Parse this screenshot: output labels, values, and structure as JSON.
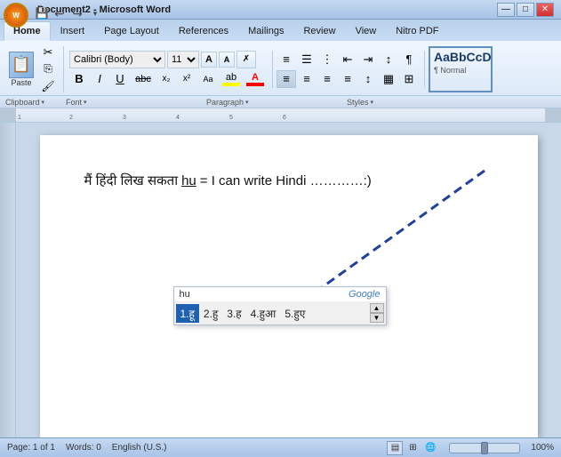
{
  "titlebar": {
    "title": "Document2 - Microsoft Word",
    "min": "—",
    "max": "□",
    "close": "✕"
  },
  "ribbon": {
    "tabs": [
      "Home",
      "Insert",
      "Page Layout",
      "References",
      "Mailings",
      "Review",
      "View",
      "Nitro PDF"
    ],
    "active_tab": "Home"
  },
  "toolbar": {
    "clipboard": "Clipboard",
    "paste": "Paste",
    "cut": "✂",
    "copy": "⎘",
    "format_painter": "🖌",
    "font_name": "Calibri (Body)",
    "font_size": "11",
    "grow": "A",
    "shrink": "A",
    "clear": "✗",
    "aa_upper": "Aa",
    "bold": "B",
    "italic": "I",
    "underline": "U",
    "strikethrough": "abc",
    "subscript": "x₂",
    "superscript": "x²",
    "font_section": "Font",
    "para_section": "Paragraph",
    "styles_section": "Styles",
    "style_preview": "AaBbCcD",
    "style_name": "¶ Normal"
  },
  "document": {
    "line1_hindi": "मैं हिंदी लिख सकता",
    "line1_typed": "hu",
    "line1_english": "= I can write Hindi …………:)",
    "cursor_text": "hu"
  },
  "autocomplete": {
    "typed": "hu",
    "google_label": "Google",
    "items": [
      {
        "id": 1,
        "text": "1.हू",
        "selected": true
      },
      {
        "id": 2,
        "text": "2.हु"
      },
      {
        "id": 3,
        "text": "3.ह"
      },
      {
        "id": 4,
        "text": "4.हुआ"
      },
      {
        "id": 5,
        "text": "5.हुए"
      }
    ]
  },
  "statusbar": {
    "page": "Page: 1 of 1",
    "words": "Words: 0",
    "lang": "English (U.S.)"
  },
  "arrow": {
    "description": "dashed blue arrow pointing down-left"
  }
}
